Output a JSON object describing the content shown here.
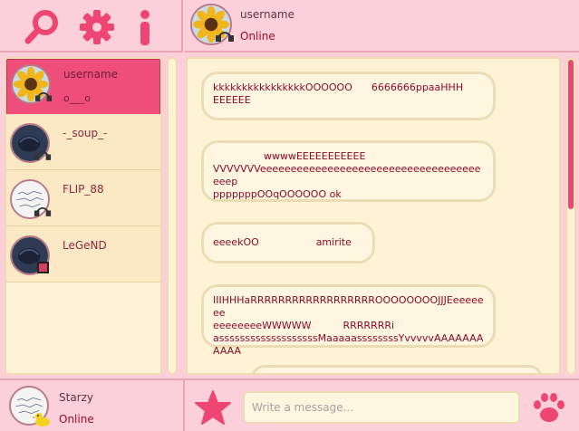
{
  "toolbar": {
    "icons": [
      "search-icon",
      "gear-icon",
      "info-icon"
    ]
  },
  "chat_header": {
    "username": "username",
    "status": "Online"
  },
  "contacts": [
    {
      "name": "username",
      "sub": "o___o",
      "avatar": "sunflower",
      "badge": "headphones"
    },
    {
      "name": "-_soup_-",
      "sub": "",
      "avatar": "dark-figure",
      "badge": "headphones"
    },
    {
      "name": "FLIP_88",
      "sub": "",
      "avatar": "sketch",
      "badge": "headphones"
    },
    {
      "name": "LeGeND",
      "sub": "",
      "avatar": "dark-figure",
      "badge": "busy-square"
    }
  ],
  "messages": [
    "kkkkkkkkkkkkkkkkOOOOOO      6666666ppaaHHH\nEEEEEE",
    "                wwwwEEEEEEEEEEE\nVVVVVVVeeeeeeeeeeeeeeeeeeeeeeeeeeeeeeeeeeeeeeep\npppppppOOqOOOOOO ok",
    "eeeekOO                  amirite",
    "IIIHHHaRRRRRRRRRRRRRRRRRROOOOOOOOJJJEeeeeeee\neeeeeeeeWWWWW          RRRRRRRi\nasssssssssssssssssssMaaaaassssssssYvvvvvAAAAAAAAAAA"
  ],
  "self": {
    "username": "Starzy",
    "status": "Online"
  },
  "composer": {
    "placeholder": "Write a message..."
  },
  "colors": {
    "accent": "#ef4d7a",
    "status": "#9a0b2c",
    "background": "#fcd0db",
    "panel": "#fff3d6"
  }
}
